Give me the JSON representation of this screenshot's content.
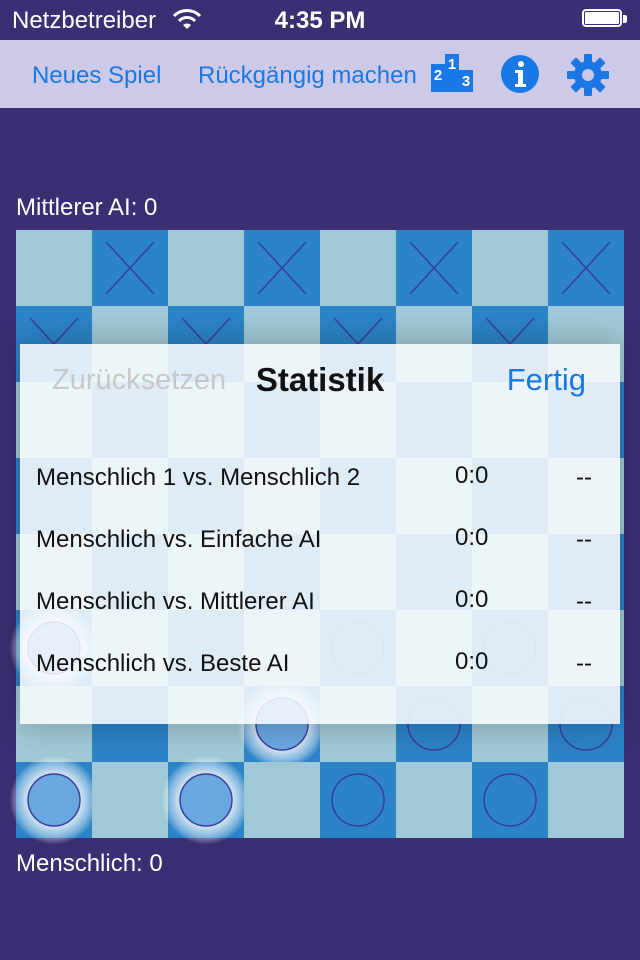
{
  "status_bar": {
    "carrier": "Netzbetreiber",
    "time": "4:35 PM"
  },
  "toolbar": {
    "new_game": "Neues Spiel",
    "undo": "Rückgängig machen",
    "ranking_icon": "podium-icon",
    "info_icon": "info-icon",
    "settings_icon": "gear-icon"
  },
  "players": {
    "top": "Mittlerer AI: 0",
    "bottom": "Menschlich: 0"
  },
  "board": {
    "rows": [
      [
        "light",
        "dark-x",
        "light",
        "dark-x",
        "light",
        "dark-x",
        "light",
        "dark-x"
      ],
      [
        "dark-v",
        "light",
        "dark-v",
        "light",
        "dark-v",
        "light",
        "dark-v",
        "light"
      ],
      [
        "light",
        "dark",
        "light",
        "dark",
        "light",
        "dark",
        "light",
        "dark"
      ],
      [
        "dark",
        "light",
        "dark",
        "light",
        "dark",
        "light",
        "dark",
        "light"
      ],
      [
        "light",
        "dark",
        "light",
        "dark",
        "light",
        "dark",
        "light",
        "dark"
      ],
      [
        "dark-o-glow",
        "light",
        "dark",
        "light",
        "dark-o",
        "light",
        "dark-o",
        "light"
      ],
      [
        "light",
        "dark",
        "light",
        "dark-o-glow",
        "light",
        "dark-o",
        "light",
        "dark-o"
      ],
      [
        "dark-o-glow",
        "light",
        "dark-o-glow",
        "light",
        "dark-o",
        "light",
        "dark-o",
        "light"
      ]
    ]
  },
  "stats": {
    "reset_label": "Zurücksetzen",
    "title": "Statistik",
    "done_label": "Fertig",
    "rows": [
      {
        "label": "Menschlich 1 vs. Menschlich 2",
        "result": "0:0",
        "extra": "--"
      },
      {
        "label": "Menschlich vs. Einfache AI",
        "result": "0:0",
        "extra": "--"
      },
      {
        "label": "Menschlich vs. Mittlerer AI",
        "result": "0:0",
        "extra": "--"
      },
      {
        "label": "Menschlich vs. Beste AI",
        "result": "0:0",
        "extra": "--"
      }
    ]
  },
  "colors": {
    "background": "#3a2f73",
    "toolbar": "#cdc9e8",
    "accent": "#1a78e6",
    "light_cell": "#9fc9d6",
    "dark_cell": "#2c83c7"
  }
}
